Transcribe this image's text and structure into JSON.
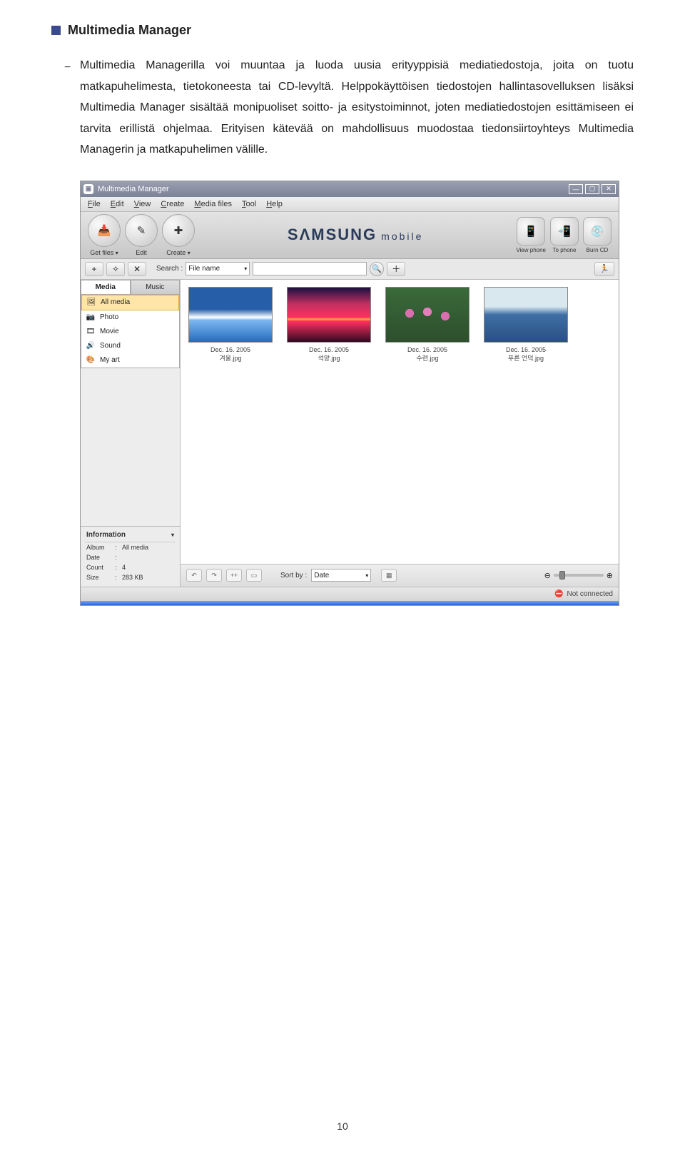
{
  "doc": {
    "section_title": "Multimedia Manager",
    "paragraph": "Multimedia Managerilla voi muuntaa ja luoda uusia erityyppisiä mediatiedostoja, joita on tuotu matkapuhelimesta, tietokoneesta tai CD-levyltä. Helppokäyttöisen tiedostojen hallintasovelluksen lisäksi Multimedia Manager sisältää monipuoliset soitto- ja esitystoiminnot, joten mediatiedostojen esittämiseen ei tarvita erillistä ohjelmaa. Erityisen kätevää on mahdollisuus muodostaa tiedonsiirtoyhteys Multimedia Managerin ja matkapuhelimen välille.",
    "page_number": "10"
  },
  "app": {
    "title": "Multimedia Manager",
    "menus": [
      "File",
      "Edit",
      "View",
      "Create",
      "Media files",
      "Tool",
      "Help"
    ],
    "brand": "SΛMSUNG",
    "brand_suffix": "mobile",
    "toolbar_left": [
      {
        "icon": "📥",
        "label": "Get files",
        "drop": true
      },
      {
        "icon": "✎",
        "label": "Edit",
        "drop": false
      },
      {
        "icon": "✚",
        "label": "Create",
        "drop": true
      }
    ],
    "toolbar_right": [
      {
        "icon": "📱",
        "label": "View phone"
      },
      {
        "icon": "📲",
        "label": "To phone"
      },
      {
        "icon": "💿",
        "label": "Burn CD"
      }
    ],
    "secbar": {
      "search_label": "Search :",
      "search_field": "File name",
      "search_value": ""
    },
    "sidebar": {
      "tabs": [
        "Media",
        "Music"
      ],
      "items": [
        {
          "icon": "🖼",
          "label": "All media",
          "active": true
        },
        {
          "icon": "📷",
          "label": "Photo"
        },
        {
          "icon": "🎞",
          "label": "Movie"
        },
        {
          "icon": "🔊",
          "label": "Sound"
        },
        {
          "icon": "🎨",
          "label": "My art"
        }
      ],
      "info_title": "Information",
      "info": [
        {
          "k": "Album",
          "v": "All media"
        },
        {
          "k": "Date",
          "v": ""
        },
        {
          "k": "Count",
          "v": "4"
        },
        {
          "k": "Size",
          "v": "283 KB"
        }
      ]
    },
    "thumbs": [
      {
        "date": "Dec. 16. 2005",
        "name": "겨울.jpg",
        "art": "art1"
      },
      {
        "date": "Dec. 16. 2005",
        "name": "석양.jpg",
        "art": "art2"
      },
      {
        "date": "Dec. 16. 2005",
        "name": "수련.jpg",
        "art": "art3"
      },
      {
        "date": "Dec. 16. 2005",
        "name": "푸른 언덕.jpg",
        "art": "art4"
      }
    ],
    "bottom": {
      "sort_label": "Sort by :",
      "sort_value": "Date"
    },
    "status": "Not connected"
  }
}
